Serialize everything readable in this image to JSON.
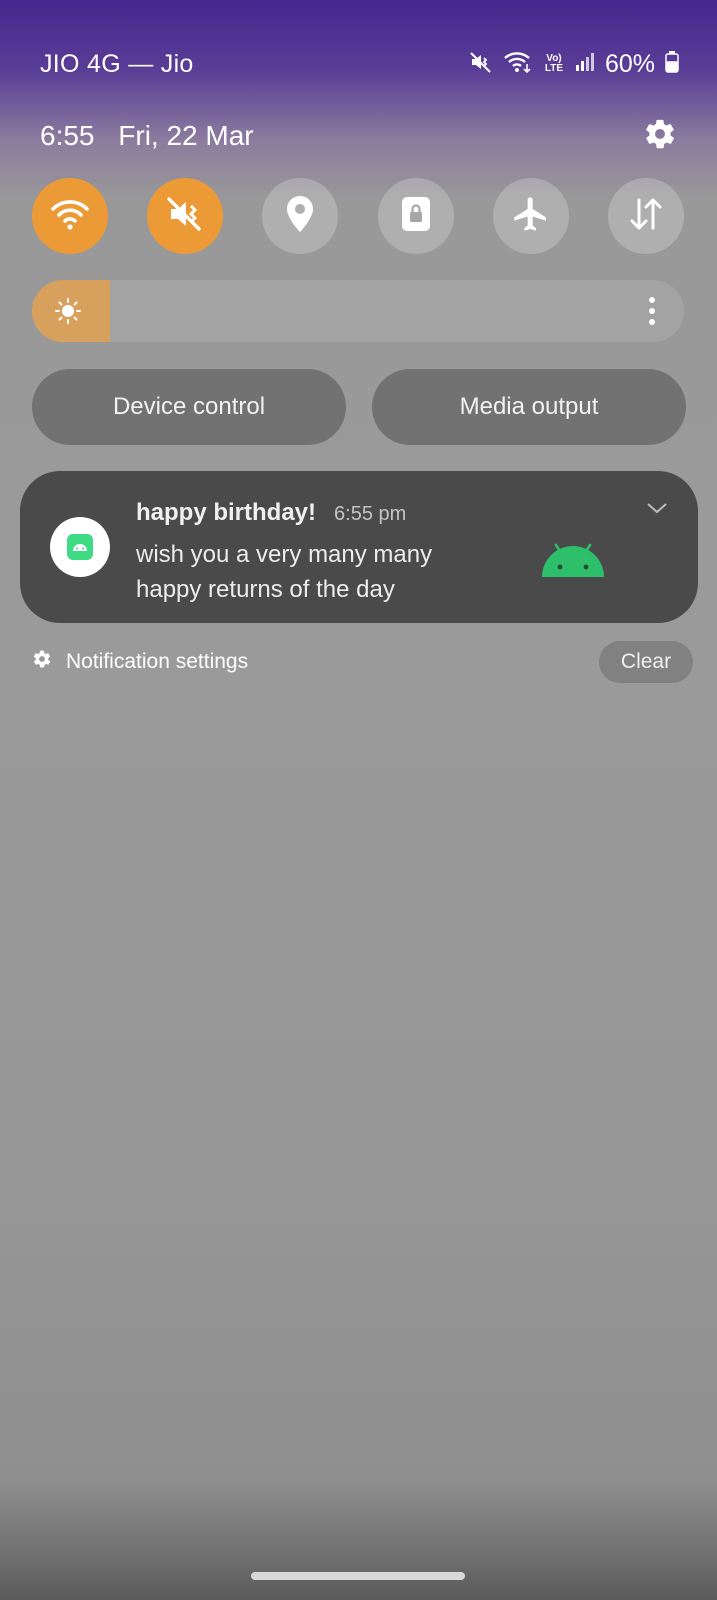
{
  "status_bar": {
    "carrier": "JIO 4G — Jio",
    "volte_label": "Vo) LTE",
    "battery_percent": "60%",
    "battery_level": 0.6,
    "icons": [
      "mute-icon",
      "wifi-icon",
      "volte-icon",
      "signal-icon",
      "battery-icon"
    ]
  },
  "header": {
    "time": "6:55",
    "date": "Fri, 22 Mar",
    "settings_icon": "gear-icon"
  },
  "quick_tiles": [
    {
      "name": "wifi",
      "icon": "wifi-icon",
      "active": true
    },
    {
      "name": "sound",
      "icon": "mute-vibrate-icon",
      "active": true
    },
    {
      "name": "location",
      "icon": "location-pin-icon",
      "active": false
    },
    {
      "name": "secure-folder",
      "icon": "lock-folder-icon",
      "active": false
    },
    {
      "name": "airplane-mode",
      "icon": "airplane-icon",
      "active": false
    },
    {
      "name": "mobile-data",
      "icon": "data-arrows-icon",
      "active": false
    }
  ],
  "brightness": {
    "level": 0.12,
    "icon": "sun-icon",
    "more_icon": "more-vertical-icon"
  },
  "controls": {
    "device_control": "Device control",
    "media_output": "Media output"
  },
  "notification": {
    "title": "happy birthday!",
    "time": "6:55 pm",
    "body_line1": "wish you a very many many",
    "body_line2": "happy returns of the day",
    "app_icon": "android-app-icon",
    "image_icon": "android-robot-icon"
  },
  "footer": {
    "settings_label": "Notification settings",
    "clear_label": "Clear"
  },
  "colors": {
    "accent": "#ec9a36",
    "android_green": "#3ddc84",
    "top_gradient": "#46278f"
  }
}
